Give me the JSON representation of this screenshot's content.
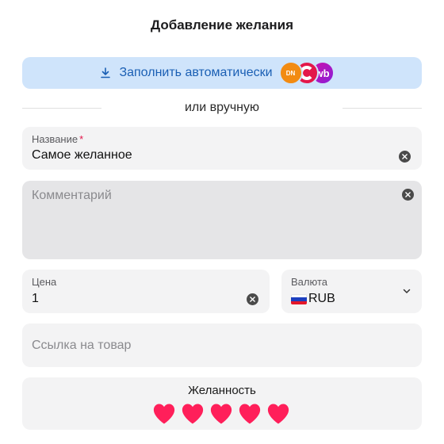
{
  "header": {
    "title": "Добавление желания"
  },
  "autofill": {
    "label": "Заполнить автоматически",
    "icon": "download-icon",
    "logos": [
      "DN",
      "",
      "wb"
    ]
  },
  "divider": {
    "text": "или вручную"
  },
  "form": {
    "name": {
      "label": "Название",
      "required_mark": "*",
      "value": "Самое желанное"
    },
    "comment": {
      "placeholder": "Комментарий"
    },
    "price": {
      "label": "Цена",
      "value": "1"
    },
    "currency": {
      "label": "Валюта",
      "value": "RUB",
      "flag": "ru-flag-icon"
    },
    "link": {
      "placeholder": "Ссылка на товар"
    },
    "desire": {
      "label": "Желанность",
      "rating": 5,
      "max": 5
    }
  },
  "colors": {
    "accent": "#1a5fb4",
    "heart": "#ff1f5a",
    "required": "#e3174a"
  }
}
